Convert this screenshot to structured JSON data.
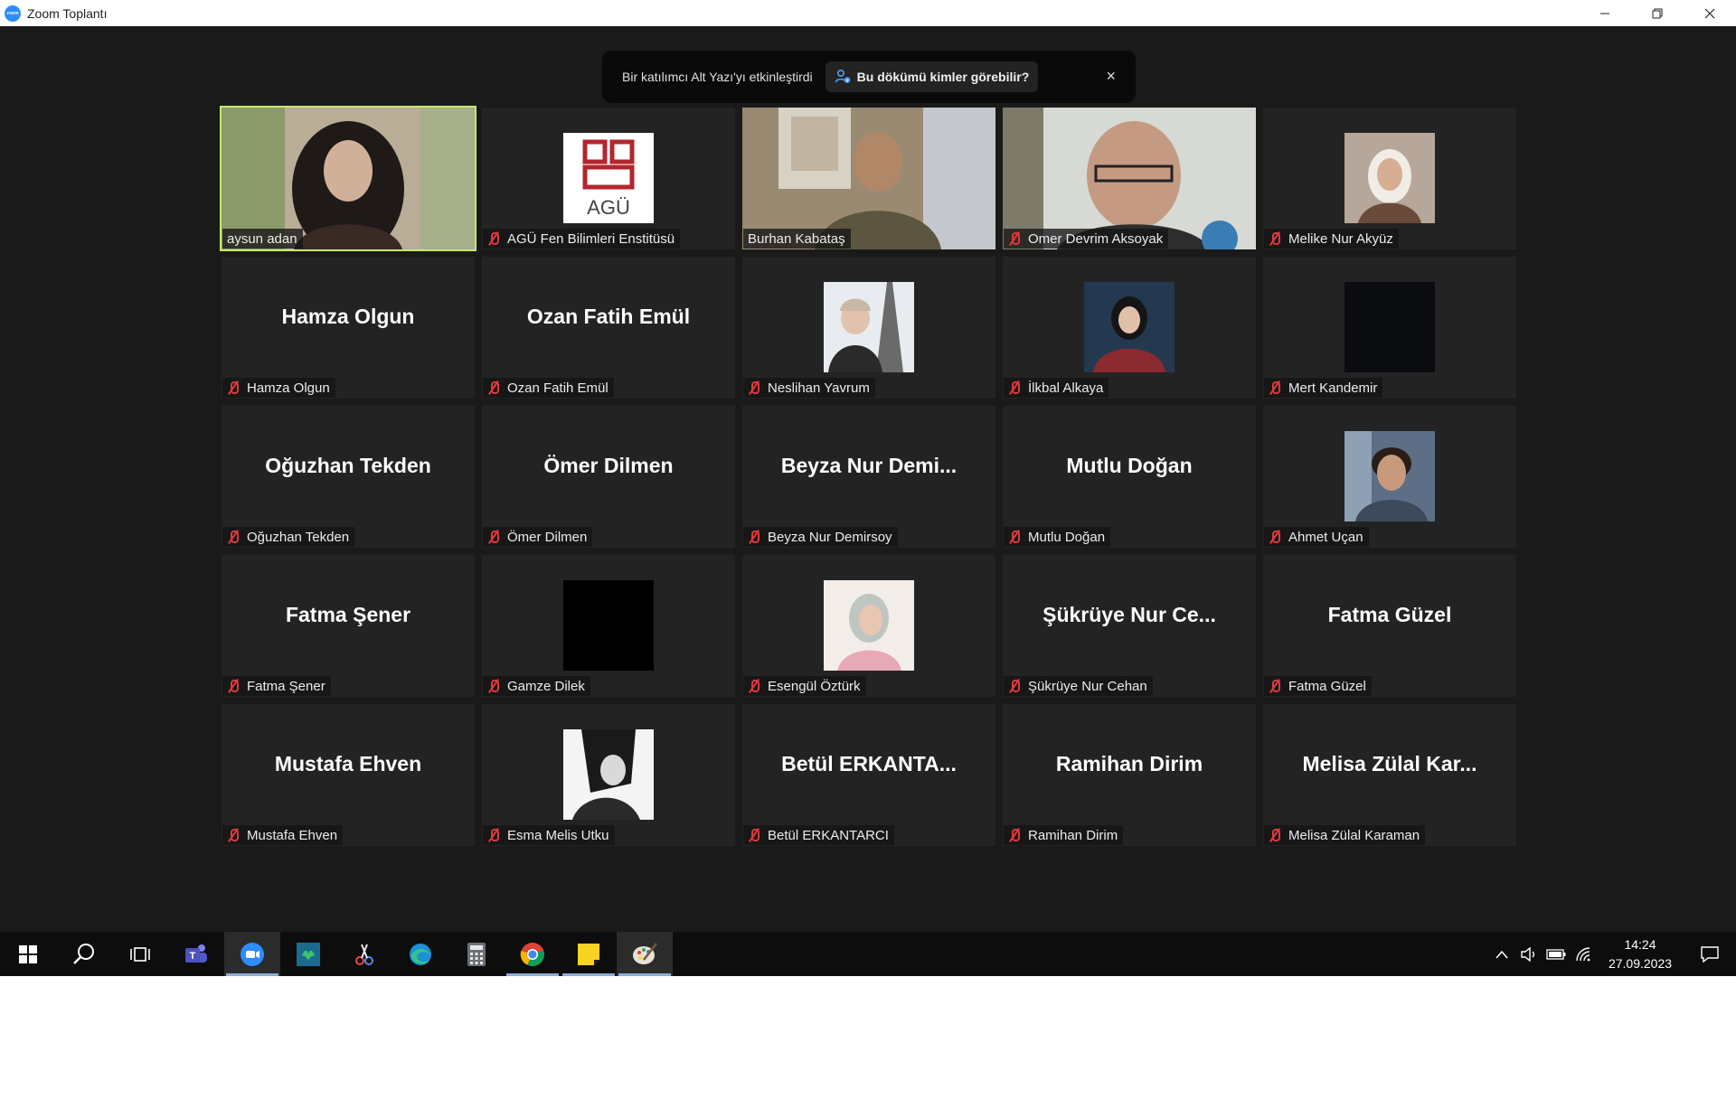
{
  "window": {
    "title": "Zoom Toplantı",
    "app_icon_text": "zoom"
  },
  "notification": {
    "text": "Bir katılımcı Alt Yazı'yı etkinleştirdi",
    "button_label": "Bu dökümü kimler görebilir?",
    "close_label": "×"
  },
  "participants": [
    {
      "label": "aysun adan",
      "muted": false,
      "tile": "video",
      "active": true
    },
    {
      "label": "AGÜ Fen Bilimleri Enstitüsü",
      "muted": true,
      "tile": "logo",
      "logo_text": "AGÜ"
    },
    {
      "label": "Burhan Kabataş",
      "muted": false,
      "tile": "video"
    },
    {
      "label": "Omer Devrim Aksoyak",
      "muted": true,
      "tile": "video"
    },
    {
      "label": "Melike Nur Akyüz",
      "muted": true,
      "tile": "photo"
    },
    {
      "label": "Hamza Olgun",
      "muted": true,
      "tile": "name",
      "display_name": "Hamza Olgun"
    },
    {
      "label": "Ozan Fatih Emül",
      "muted": true,
      "tile": "name",
      "display_name": "Ozan Fatih Emül"
    },
    {
      "label": "Neslihan Yavrum",
      "muted": true,
      "tile": "photo"
    },
    {
      "label": "İlkbal Alkaya",
      "muted": true,
      "tile": "photo"
    },
    {
      "label": "Mert Kandemir",
      "muted": true,
      "tile": "photo"
    },
    {
      "label": "Oğuzhan Tekden",
      "muted": true,
      "tile": "name",
      "display_name": "Oğuzhan Tekden"
    },
    {
      "label": "Ömer Dilmen",
      "muted": true,
      "tile": "name",
      "display_name": "Ömer Dilmen"
    },
    {
      "label": "Beyza Nur Demirsoy",
      "muted": true,
      "tile": "name",
      "display_name": "Beyza  Nur  Demi..."
    },
    {
      "label": "Mutlu Doğan",
      "muted": true,
      "tile": "name",
      "display_name": "Mutlu Doğan"
    },
    {
      "label": "Ahmet Uçan",
      "muted": true,
      "tile": "photo"
    },
    {
      "label": "Fatma Şener",
      "muted": true,
      "tile": "name",
      "display_name": "Fatma Şener"
    },
    {
      "label": "Gamze Dilek",
      "muted": true,
      "tile": "photo"
    },
    {
      "label": "Esengül Öztürk",
      "muted": true,
      "tile": "photo"
    },
    {
      "label": "Şükrüye Nur Cehan",
      "muted": true,
      "tile": "name",
      "display_name": "Şükrüye Nur Ce..."
    },
    {
      "label": "Fatma Güzel",
      "muted": true,
      "tile": "name",
      "display_name": "Fatma Güzel"
    },
    {
      "label": "Mustafa Ehven",
      "muted": true,
      "tile": "name",
      "display_name": "Mustafa Ehven"
    },
    {
      "label": "Esma Melis Utku",
      "muted": true,
      "tile": "photo"
    },
    {
      "label": "Betül ERKANTARCI",
      "muted": true,
      "tile": "name",
      "display_name": "Betül  ERKANTA..."
    },
    {
      "label": "Ramihan Dirim",
      "muted": true,
      "tile": "name",
      "display_name": "Ramihan Dirim"
    },
    {
      "label": "Melisa Zülal Karaman",
      "muted": true,
      "tile": "name",
      "display_name": "Melisa  Zülal  Kar..."
    }
  ],
  "taskbar": {
    "items": [
      "start-icon",
      "search-icon",
      "task-view-icon",
      "teams-icon",
      "zoom-icon",
      "app-icon",
      "snipping-icon",
      "edge-icon",
      "calculator-icon",
      "chrome-icon",
      "sticky-notes-icon",
      "paint-icon"
    ],
    "time": "14:24",
    "date": "27.09.2023"
  }
}
